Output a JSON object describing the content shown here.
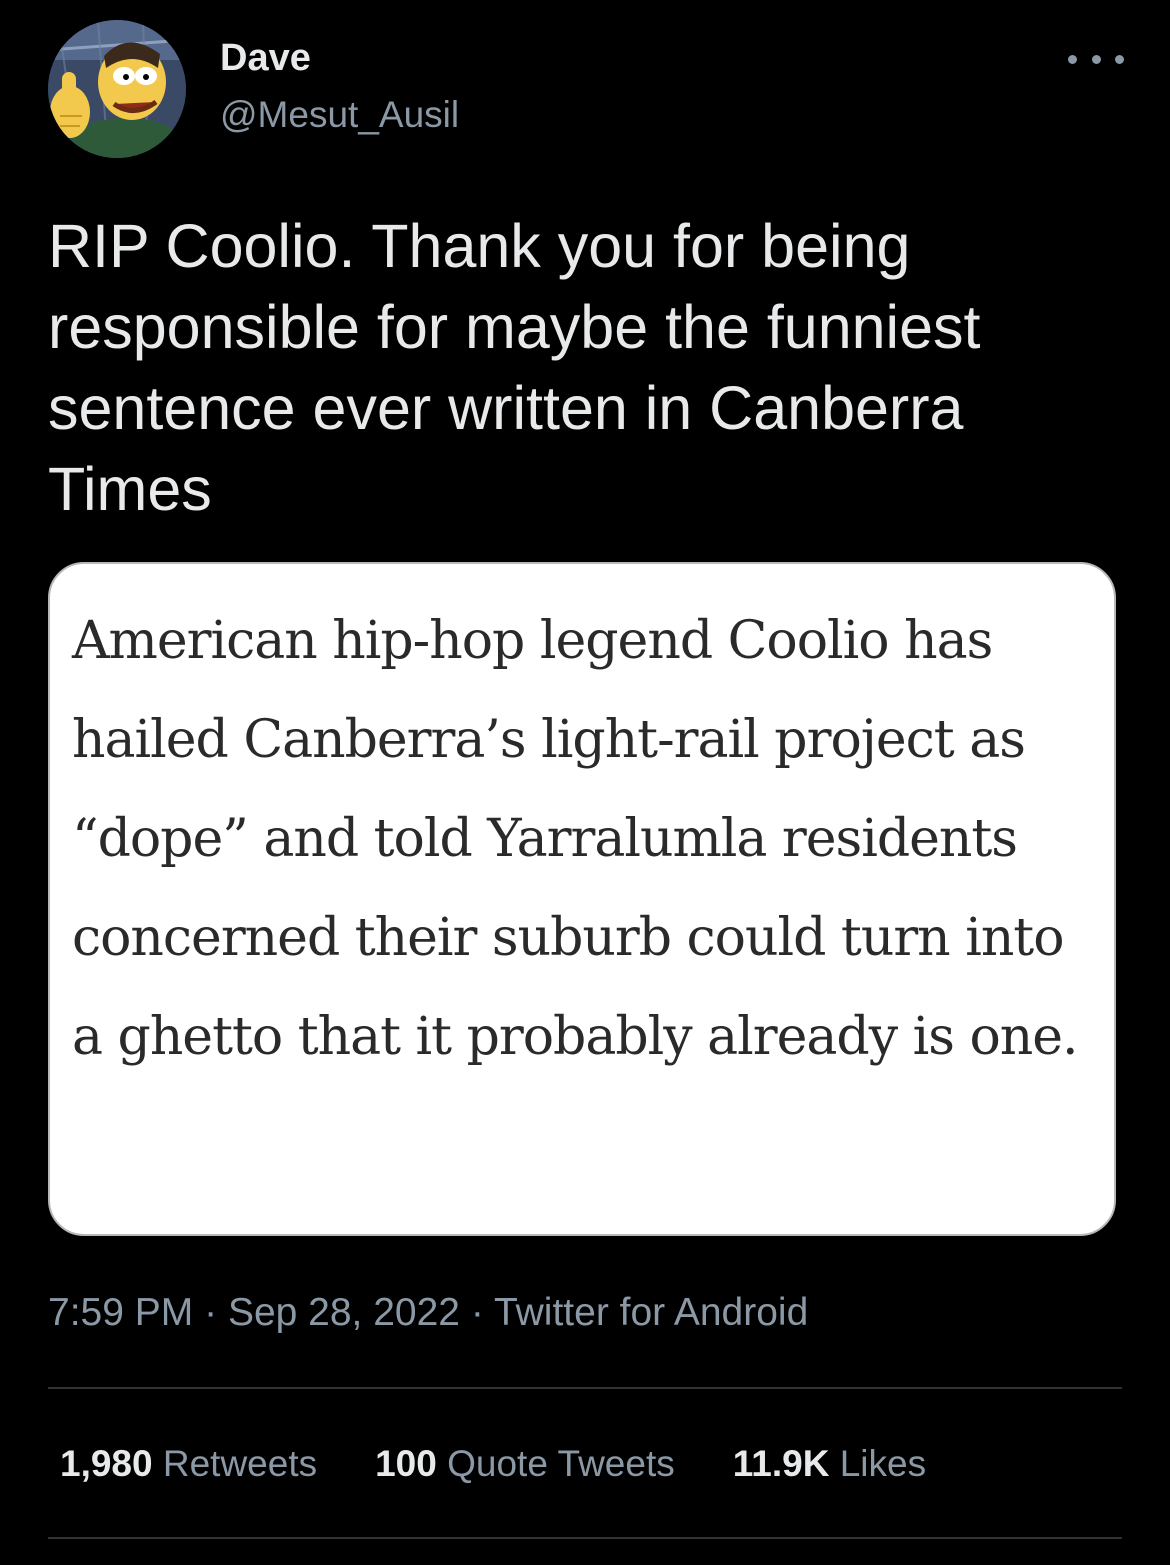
{
  "tweet": {
    "author": {
      "display_name": "Dave",
      "handle": "@Mesut_Ausil",
      "avatar_icon": "cartoon-avatar-icon"
    },
    "more_icon": "more-options-icon",
    "text": "RIP Coolio. Thank you for being responsible for maybe the funniest sentence ever written in Canberra Times",
    "quoted_image_text": "American hip-hop legend Coolio has hailed Canberra’s light-rail project as “dope” and told Yarralumla residents concerned their suburb could turn into a ghetto that it probably already is one.",
    "meta": {
      "time": "7:59 PM",
      "separator": "·",
      "date": "Sep 28, 2022",
      "source": "Twitter for Android"
    },
    "stats": {
      "retweets_count": "1,980",
      "retweets_label": "Retweets",
      "quotes_count": "100",
      "quotes_label": "Quote Tweets",
      "likes_count": "11.9K",
      "likes_label": "Likes"
    }
  },
  "colors": {
    "background": "#000000",
    "primary_text": "#e7e9ea",
    "secondary_text": "#8b98a5",
    "divider": "#2f3336",
    "card_background": "#ffffff"
  }
}
